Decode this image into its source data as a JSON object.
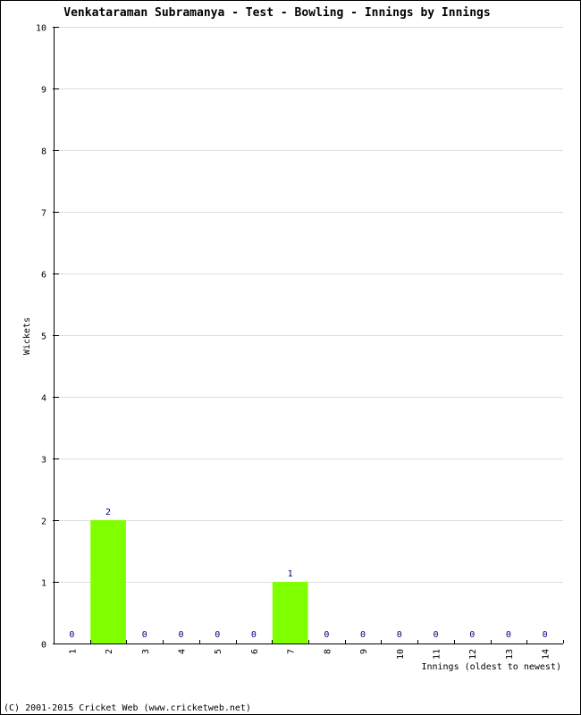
{
  "chart_data": {
    "type": "bar",
    "title": "Venkataraman Subramanya - Test - Bowling - Innings by Innings",
    "xlabel": "Innings (oldest to newest)",
    "ylabel": "Wickets",
    "categories": [
      "1",
      "2",
      "3",
      "4",
      "5",
      "6",
      "7",
      "8",
      "9",
      "10",
      "11",
      "12",
      "13",
      "14"
    ],
    "values": [
      0,
      2,
      0,
      0,
      0,
      0,
      1,
      0,
      0,
      0,
      0,
      0,
      0,
      0
    ],
    "ylim": [
      0,
      10
    ],
    "yticks": [
      0,
      1,
      2,
      3,
      4,
      5,
      6,
      7,
      8,
      9,
      10
    ],
    "grid": true,
    "legend": "none",
    "bar_color": "#80ff00",
    "value_label_color": "#000080"
  },
  "footer": "(C) 2001-2015 Cricket Web (www.cricketweb.net)"
}
